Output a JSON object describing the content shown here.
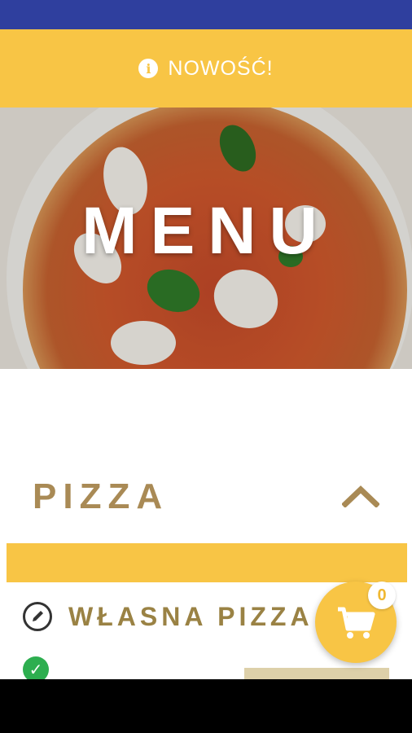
{
  "banner": {
    "label": "NOWOŚĆ!",
    "icon": "info-icon"
  },
  "hero": {
    "title": "MENU"
  },
  "section": {
    "title": "PIZZA",
    "toggle_icon": "chevron-up-icon"
  },
  "items": [
    {
      "label": "WŁASNA PIZZA",
      "icon": "edit-icon"
    }
  ],
  "cart": {
    "count": "0",
    "icon": "cart-icon"
  },
  "colors": {
    "status_bar": "#2f3f9e",
    "accent": "#f8c545",
    "section_title": "#a98a55",
    "item_title": "#9a8244",
    "check": "#2dae4f"
  }
}
